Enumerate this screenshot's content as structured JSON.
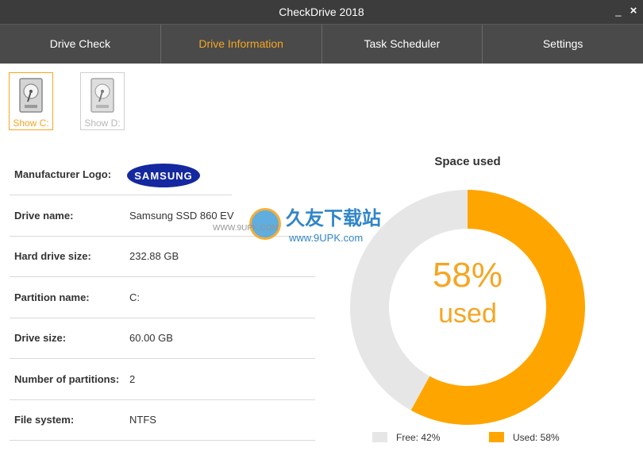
{
  "window": {
    "title": "CheckDrive 2018",
    "minimize_glyph": "_",
    "close_glyph": "×"
  },
  "tabs": [
    {
      "label": "Drive Check",
      "active": false
    },
    {
      "label": "Drive Information",
      "active": true
    },
    {
      "label": "Task Scheduler",
      "active": false
    },
    {
      "label": "Settings",
      "active": false
    }
  ],
  "drives": [
    {
      "label": "Show C:",
      "selected": true,
      "icon": "hard-drive-icon"
    },
    {
      "label": "Show D:",
      "selected": false,
      "icon": "hard-drive-icon"
    }
  ],
  "info": {
    "manufacturer_logo_label": "Manufacturer Logo:",
    "manufacturer_logo_text": "SAMSUNG",
    "rows": [
      {
        "key": "Drive name:",
        "value": "Samsung SSD 860 EV"
      },
      {
        "key": "Hard drive size:",
        "value": "232.88 GB"
      },
      {
        "key": "Partition name:",
        "value": "C:"
      },
      {
        "key": "Drive size:",
        "value": "60.00 GB"
      },
      {
        "key": "Number of partitions:",
        "value": "2"
      },
      {
        "key": "File system:",
        "value": "NTFS"
      }
    ]
  },
  "space": {
    "title": "Space used",
    "used_fraction": 0.58,
    "percent_text": "58%",
    "used_text": "used",
    "legend": [
      {
        "label": "Free: 42%",
        "color": "#e6e6e6"
      },
      {
        "label": "Used: 58%",
        "color": "#ffa500"
      }
    ]
  },
  "watermark": {
    "text": "久友下载站",
    "url": "www.9UPK.com",
    "url_small": "WWW.9UPK.COM"
  },
  "colors": {
    "accent": "#f5a623",
    "used": "#ffa500",
    "free": "#e6e6e6",
    "titlebar": "#3c3c3c",
    "tabbar": "#4a4a4a"
  }
}
